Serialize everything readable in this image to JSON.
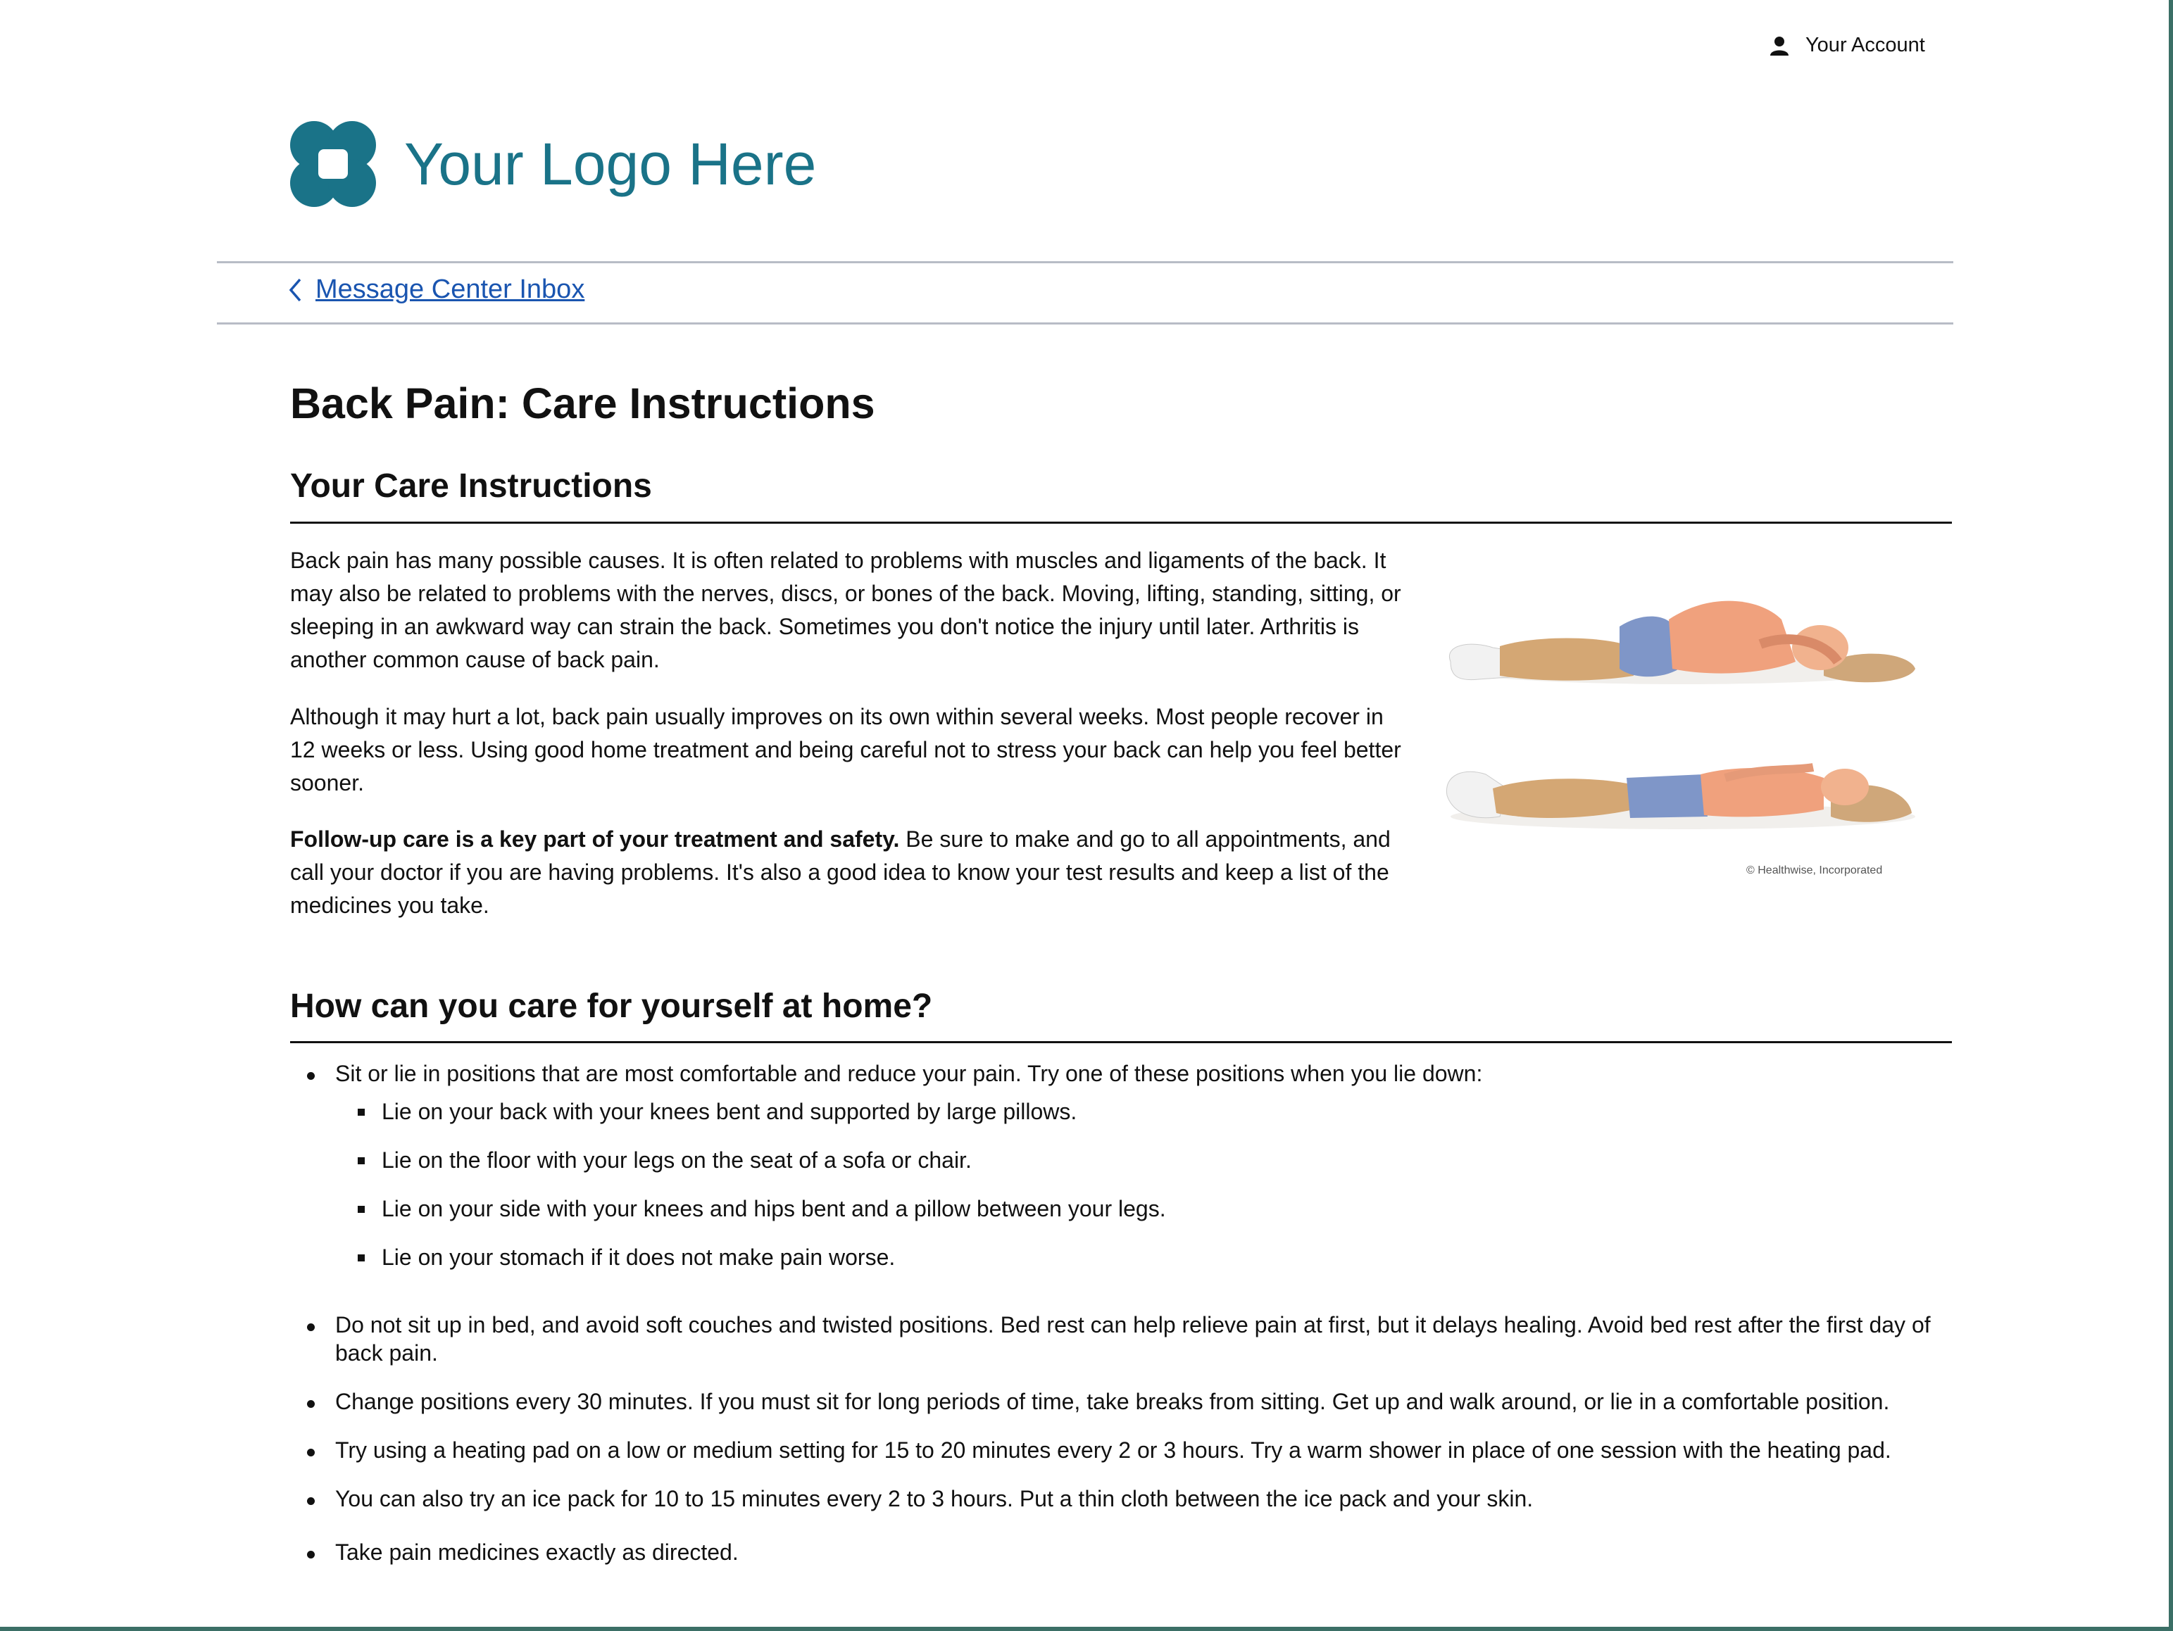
{
  "header": {
    "account_label": "Your Account",
    "logo_text": "Your Logo Here",
    "back_link_label": "Message Center Inbox"
  },
  "article": {
    "title": "Back Pain: Care Instructions",
    "section1_heading": "Your Care Instructions",
    "paragraphs": [
      "Back pain has many possible causes. It is often related to problems with muscles and ligaments of the back. It may also be related to problems with the nerves, discs, or bones of the back. Moving, lifting, standing, sitting, or sleeping in an awkward way can strain the back. Sometimes you don't notice the injury until later. Arthritis is another common cause of back pain.",
      "Although it may hurt a lot, back pain usually improves on its own within several weeks. Most people recover in 12 weeks or less. Using good home treatment and being careful not to stress your back can help you feel better sooner."
    ],
    "followup_bold": "Follow-up care is a key part of your treatment and safety.",
    "followup_rest": " Be sure to make and go to all appointments, and call your doctor if you are having problems. It's also a good idea to know your test results and keep a list of the medicines you take.",
    "image_credit": "© Healthwise, Incorporated",
    "section2_heading": "How can you care for yourself at home?",
    "bullets": [
      "Sit or lie in positions that are most comfortable and reduce your pain. Try one of these positions when you lie down:",
      "Do not sit up in bed, and avoid soft couches and twisted positions. Bed rest can help relieve pain at first, but it delays healing. Avoid bed rest after the first day of back pain.",
      "Change positions every 30 minutes. If you must sit for long periods of time, take breaks from sitting. Get up and walk around, or lie in a comfortable position.",
      "Try using a heating pad on a low or medium setting for 15 to 20 minutes every 2 or 3 hours. Try a warm shower in place of one session with the heating pad.",
      "You can also try an ice pack for 10 to 15 minutes every 2 to 3 hours. Put a thin cloth between the ice pack and your skin.",
      "Take pain medicines exactly as directed."
    ],
    "sub_bullets": [
      "Lie on your back with your knees bent and supported by large pillows.",
      "Lie on the floor with your legs on the seat of a sofa or chair.",
      "Lie on your side with your knees and hips bent and a pillow between your legs.",
      "Lie on your stomach if it does not make pain worse."
    ]
  },
  "colors": {
    "logo": "#1a7388",
    "link": "#1a55b0",
    "frame": "#3b6f66"
  }
}
